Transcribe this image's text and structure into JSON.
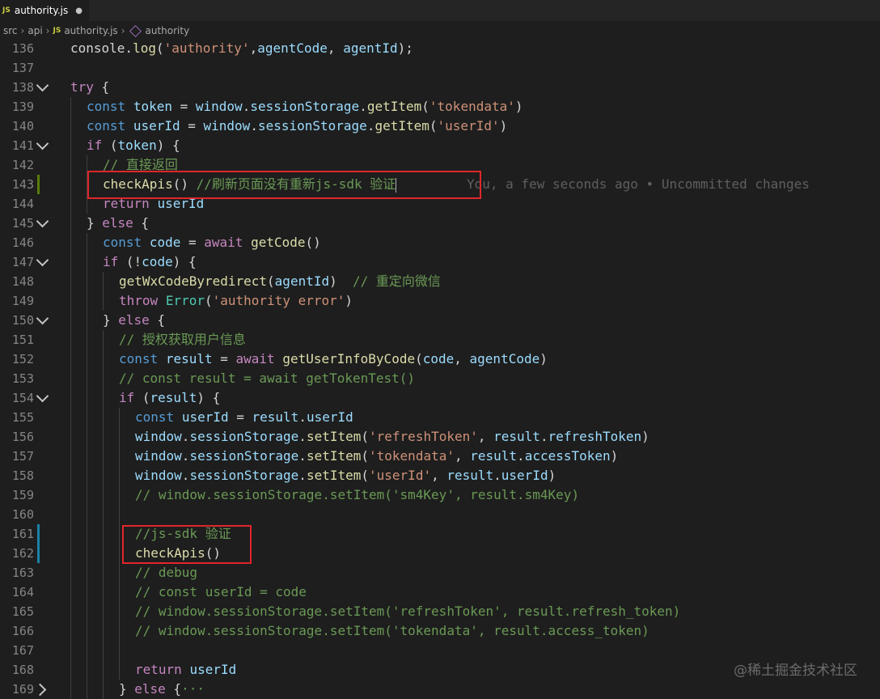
{
  "tab": {
    "badge": "JS",
    "filename": "authority.js",
    "modified": "●"
  },
  "breadcrumb": [
    "src",
    "api",
    "authority.js",
    "authority"
  ],
  "blame": "You, a few seconds ago • Uncommitted changes",
  "watermark": "@稀土掘金技术社区",
  "lines": [
    {
      "n": "136",
      "fold": "",
      "indent": 1,
      "mark": "",
      "tokens": [
        [
          "plain",
          "console."
        ],
        [
          "fn",
          "log"
        ],
        [
          "plain",
          "("
        ],
        [
          "str",
          "'authority'"
        ],
        [
          "plain",
          ","
        ],
        [
          "var",
          "agentCode"
        ],
        [
          "plain",
          ", "
        ],
        [
          "var",
          "agentId"
        ],
        [
          "plain",
          ");"
        ]
      ]
    },
    {
      "n": "137",
      "fold": "",
      "indent": 0,
      "mark": "",
      "tokens": []
    },
    {
      "n": "138",
      "fold": "down",
      "indent": 1,
      "mark": "",
      "tokens": [
        [
          "ctl",
          "try"
        ],
        [
          "plain",
          " {"
        ]
      ]
    },
    {
      "n": "139",
      "fold": "",
      "indent": 2,
      "mark": "",
      "tokens": [
        [
          "kw",
          "const"
        ],
        [
          "plain",
          " "
        ],
        [
          "var",
          "token"
        ],
        [
          "plain",
          " = "
        ],
        [
          "var",
          "window"
        ],
        [
          "plain",
          "."
        ],
        [
          "var",
          "sessionStorage"
        ],
        [
          "plain",
          "."
        ],
        [
          "fn",
          "getItem"
        ],
        [
          "plain",
          "("
        ],
        [
          "str",
          "'tokendata'"
        ],
        [
          "plain",
          ")"
        ]
      ]
    },
    {
      "n": "140",
      "fold": "",
      "indent": 2,
      "mark": "",
      "tokens": [
        [
          "kw",
          "const"
        ],
        [
          "plain",
          " "
        ],
        [
          "var",
          "userId"
        ],
        [
          "plain",
          " = "
        ],
        [
          "var",
          "window"
        ],
        [
          "plain",
          "."
        ],
        [
          "var",
          "sessionStorage"
        ],
        [
          "plain",
          "."
        ],
        [
          "fn",
          "getItem"
        ],
        [
          "plain",
          "("
        ],
        [
          "str",
          "'userId'"
        ],
        [
          "plain",
          ")"
        ]
      ]
    },
    {
      "n": "141",
      "fold": "down",
      "indent": 2,
      "mark": "",
      "tokens": [
        [
          "ctl",
          "if"
        ],
        [
          "plain",
          " ("
        ],
        [
          "var",
          "token"
        ],
        [
          "plain",
          ") {"
        ]
      ]
    },
    {
      "n": "142",
      "fold": "",
      "indent": 3,
      "mark": "",
      "tokens": [
        [
          "cmt",
          "// 直接返回"
        ]
      ]
    },
    {
      "n": "143",
      "fold": "",
      "indent": 3,
      "mark": "#587c0c",
      "tokens": [
        [
          "fn",
          "checkApis"
        ],
        [
          "plain",
          "() "
        ],
        [
          "cmt",
          "//刷新页面没有重新js-sdk 验证"
        ]
      ],
      "cursor": true,
      "blame": true
    },
    {
      "n": "144",
      "fold": "",
      "indent": 3,
      "mark": "",
      "tokens": [
        [
          "ctl",
          "return"
        ],
        [
          "plain",
          " "
        ],
        [
          "var",
          "userId"
        ]
      ]
    },
    {
      "n": "145",
      "fold": "down",
      "indent": 2,
      "mark": "",
      "tokens": [
        [
          "plain",
          "} "
        ],
        [
          "ctl",
          "else"
        ],
        [
          "plain",
          " {"
        ]
      ]
    },
    {
      "n": "146",
      "fold": "",
      "indent": 3,
      "mark": "",
      "tokens": [
        [
          "kw",
          "const"
        ],
        [
          "plain",
          " "
        ],
        [
          "var",
          "code"
        ],
        [
          "plain",
          " = "
        ],
        [
          "ctl",
          "await"
        ],
        [
          "plain",
          " "
        ],
        [
          "fn",
          "getCode"
        ],
        [
          "plain",
          "()"
        ]
      ]
    },
    {
      "n": "147",
      "fold": "down",
      "indent": 3,
      "mark": "",
      "tokens": [
        [
          "ctl",
          "if"
        ],
        [
          "plain",
          " (!"
        ],
        [
          "var",
          "code"
        ],
        [
          "plain",
          ") {"
        ]
      ]
    },
    {
      "n": "148",
      "fold": "",
      "indent": 4,
      "mark": "",
      "tokens": [
        [
          "fn",
          "getWxCodeByredirect"
        ],
        [
          "plain",
          "("
        ],
        [
          "var",
          "agentId"
        ],
        [
          "plain",
          ")  "
        ],
        [
          "cmt",
          "// 重定向微信"
        ]
      ]
    },
    {
      "n": "149",
      "fold": "",
      "indent": 4,
      "mark": "",
      "tokens": [
        [
          "ctl",
          "throw"
        ],
        [
          "plain",
          " "
        ],
        [
          "cls",
          "Error"
        ],
        [
          "plain",
          "("
        ],
        [
          "str",
          "'authority error'"
        ],
        [
          "plain",
          ")"
        ]
      ]
    },
    {
      "n": "150",
      "fold": "down",
      "indent": 3,
      "mark": "",
      "tokens": [
        [
          "plain",
          "} "
        ],
        [
          "ctl",
          "else"
        ],
        [
          "plain",
          " {"
        ]
      ]
    },
    {
      "n": "151",
      "fold": "",
      "indent": 4,
      "mark": "",
      "tokens": [
        [
          "cmt",
          "// 授权获取用户信息"
        ]
      ]
    },
    {
      "n": "152",
      "fold": "",
      "indent": 4,
      "mark": "",
      "tokens": [
        [
          "kw",
          "const"
        ],
        [
          "plain",
          " "
        ],
        [
          "var",
          "result"
        ],
        [
          "plain",
          " = "
        ],
        [
          "ctl",
          "await"
        ],
        [
          "plain",
          " "
        ],
        [
          "fn",
          "getUserInfoByCode"
        ],
        [
          "plain",
          "("
        ],
        [
          "var",
          "code"
        ],
        [
          "plain",
          ", "
        ],
        [
          "var",
          "agentCode"
        ],
        [
          "plain",
          ")"
        ]
      ]
    },
    {
      "n": "153",
      "fold": "",
      "indent": 4,
      "mark": "",
      "tokens": [
        [
          "cmt",
          "// const result = await getTokenTest()"
        ]
      ]
    },
    {
      "n": "154",
      "fold": "down",
      "indent": 4,
      "mark": "",
      "tokens": [
        [
          "ctl",
          "if"
        ],
        [
          "plain",
          " ("
        ],
        [
          "var",
          "result"
        ],
        [
          "plain",
          ") {"
        ]
      ]
    },
    {
      "n": "155",
      "fold": "",
      "indent": 5,
      "mark": "",
      "tokens": [
        [
          "kw",
          "const"
        ],
        [
          "plain",
          " "
        ],
        [
          "var",
          "userId"
        ],
        [
          "plain",
          " = "
        ],
        [
          "var",
          "result"
        ],
        [
          "plain",
          "."
        ],
        [
          "var",
          "userId"
        ]
      ]
    },
    {
      "n": "156",
      "fold": "",
      "indent": 5,
      "mark": "",
      "tokens": [
        [
          "var",
          "window"
        ],
        [
          "plain",
          "."
        ],
        [
          "var",
          "sessionStorage"
        ],
        [
          "plain",
          "."
        ],
        [
          "fn",
          "setItem"
        ],
        [
          "plain",
          "("
        ],
        [
          "str",
          "'refreshToken'"
        ],
        [
          "plain",
          ", "
        ],
        [
          "var",
          "result"
        ],
        [
          "plain",
          "."
        ],
        [
          "var",
          "refreshToken"
        ],
        [
          "plain",
          ")"
        ]
      ]
    },
    {
      "n": "157",
      "fold": "",
      "indent": 5,
      "mark": "",
      "tokens": [
        [
          "var",
          "window"
        ],
        [
          "plain",
          "."
        ],
        [
          "var",
          "sessionStorage"
        ],
        [
          "plain",
          "."
        ],
        [
          "fn",
          "setItem"
        ],
        [
          "plain",
          "("
        ],
        [
          "str",
          "'tokendata'"
        ],
        [
          "plain",
          ", "
        ],
        [
          "var",
          "result"
        ],
        [
          "plain",
          "."
        ],
        [
          "var",
          "accessToken"
        ],
        [
          "plain",
          ")"
        ]
      ]
    },
    {
      "n": "158",
      "fold": "",
      "indent": 5,
      "mark": "",
      "tokens": [
        [
          "var",
          "window"
        ],
        [
          "plain",
          "."
        ],
        [
          "var",
          "sessionStorage"
        ],
        [
          "plain",
          "."
        ],
        [
          "fn",
          "setItem"
        ],
        [
          "plain",
          "("
        ],
        [
          "str",
          "'userId'"
        ],
        [
          "plain",
          ", "
        ],
        [
          "var",
          "result"
        ],
        [
          "plain",
          "."
        ],
        [
          "var",
          "userId"
        ],
        [
          "plain",
          ")"
        ]
      ]
    },
    {
      "n": "159",
      "fold": "",
      "indent": 5,
      "mark": "",
      "tokens": [
        [
          "cmt",
          "// window.sessionStorage.setItem('sm4Key', result.sm4Key)"
        ]
      ]
    },
    {
      "n": "160",
      "fold": "",
      "indent": 0,
      "mark": "",
      "tokens": []
    },
    {
      "n": "161",
      "fold": "",
      "indent": 5,
      "mark": "#1b81a8",
      "tokens": [
        [
          "cmt",
          "//js-sdk 验证"
        ]
      ]
    },
    {
      "n": "162",
      "fold": "",
      "indent": 5,
      "mark": "#1b81a8",
      "tokens": [
        [
          "fn",
          "checkApis"
        ],
        [
          "plain",
          "()"
        ]
      ]
    },
    {
      "n": "163",
      "fold": "",
      "indent": 5,
      "mark": "",
      "tokens": [
        [
          "cmt",
          "// debug"
        ]
      ]
    },
    {
      "n": "164",
      "fold": "",
      "indent": 5,
      "mark": "",
      "tokens": [
        [
          "cmt",
          "// const userId = code"
        ]
      ]
    },
    {
      "n": "165",
      "fold": "",
      "indent": 5,
      "mark": "",
      "tokens": [
        [
          "cmt",
          "// window.sessionStorage.setItem('refreshToken', result.refresh_token)"
        ]
      ]
    },
    {
      "n": "166",
      "fold": "",
      "indent": 5,
      "mark": "",
      "tokens": [
        [
          "cmt",
          "// window.sessionStorage.setItem('tokendata', result.access_token)"
        ]
      ]
    },
    {
      "n": "167",
      "fold": "",
      "indent": 0,
      "mark": "",
      "tokens": []
    },
    {
      "n": "168",
      "fold": "",
      "indent": 5,
      "mark": "",
      "tokens": [
        [
          "ctl",
          "return"
        ],
        [
          "plain",
          " "
        ],
        [
          "var",
          "userId"
        ]
      ]
    },
    {
      "n": "169",
      "fold": "right",
      "indent": 4,
      "mark": "",
      "tokens": [
        [
          "plain",
          "} "
        ],
        [
          "ctl",
          "else"
        ],
        [
          "plain",
          " {"
        ],
        [
          "cmt",
          "···"
        ]
      ]
    }
  ],
  "highlights": [
    "line-143",
    "lines-161-162"
  ]
}
